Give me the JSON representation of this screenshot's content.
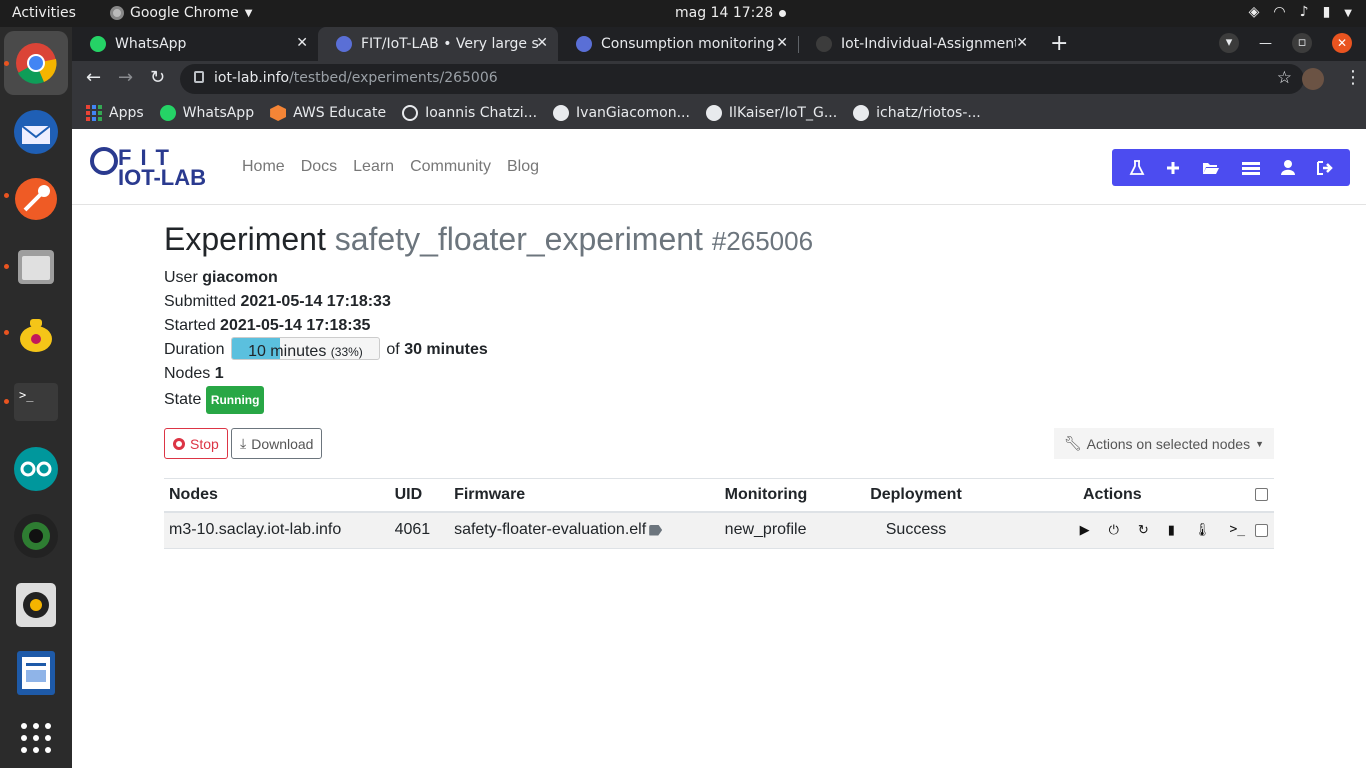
{
  "topbar": {
    "activities": "Activities",
    "app_name": "Google Chrome",
    "clock": "mag 14  17:28"
  },
  "tabs": [
    {
      "label": "WhatsApp",
      "favicon_color": "#25d366"
    },
    {
      "label": "FIT/IoT-LAB • Very large sc",
      "favicon_color": "#5a6fd6"
    },
    {
      "label": "Consumption monitoring",
      "favicon_color": "#5a6fd6"
    },
    {
      "label": "Iot-Individual-Assignment",
      "favicon_color": "#3c3c3c"
    }
  ],
  "address": {
    "host": "iot-lab.info",
    "path": "/testbed/experiments/265006"
  },
  "bookmarks": [
    {
      "label": "Apps",
      "icon": "apps-grid-icon"
    },
    {
      "label": "WhatsApp",
      "icon": "whatsapp-icon"
    },
    {
      "label": "AWS Educate",
      "icon": "aws-icon"
    },
    {
      "label": "Ioannis Chatzi...",
      "icon": "globe-icon"
    },
    {
      "label": "IvanGiacomon...",
      "icon": "github-icon"
    },
    {
      "label": "IlKaiser/IoT_G...",
      "icon": "github-icon"
    },
    {
      "label": "ichatz/riotos-...",
      "icon": "github-icon"
    }
  ],
  "site": {
    "logo_top": "FIT",
    "logo_bottom": "IOT-LAB",
    "nav": [
      "Home",
      "Docs",
      "Learn",
      "Community",
      "Blog"
    ]
  },
  "experiment": {
    "heading": "Experiment",
    "name": "safety_floater_experiment",
    "id": "#265006",
    "user_label": "User",
    "user": "giacomon",
    "submitted_label": "Submitted",
    "submitted": "2021-05-14 17:18:33",
    "started_label": "Started",
    "started": "2021-05-14 17:18:35",
    "duration_label": "Duration",
    "duration_elapsed": "10 minutes",
    "duration_percent_text": "(33%)",
    "duration_progress": 0.33,
    "duration_of": "of",
    "duration_total": "30 minutes",
    "nodes_label": "Nodes",
    "nodes_count": "1",
    "state_label": "State",
    "state": "Running"
  },
  "actions": {
    "stop": "Stop",
    "download": "Download",
    "selected_nodes": "Actions on selected nodes"
  },
  "table": {
    "headers": {
      "nodes": "Nodes",
      "uid": "UID",
      "firmware": "Firmware",
      "monitoring": "Monitoring",
      "deployment": "Deployment",
      "actions": "Actions"
    },
    "rows": [
      {
        "node": "m3-10.saclay.iot-lab.info",
        "uid": "4061",
        "firmware": "safety-floater-evaluation.elf",
        "monitoring": "new_profile",
        "deployment": "Success"
      }
    ]
  },
  "colors": {
    "brand": "#2a3a8f",
    "toolbar": "#4c4cf0",
    "running_badge": "#28a745",
    "progress_fill": "#5bc0de",
    "stop_button": "#dc3545"
  }
}
